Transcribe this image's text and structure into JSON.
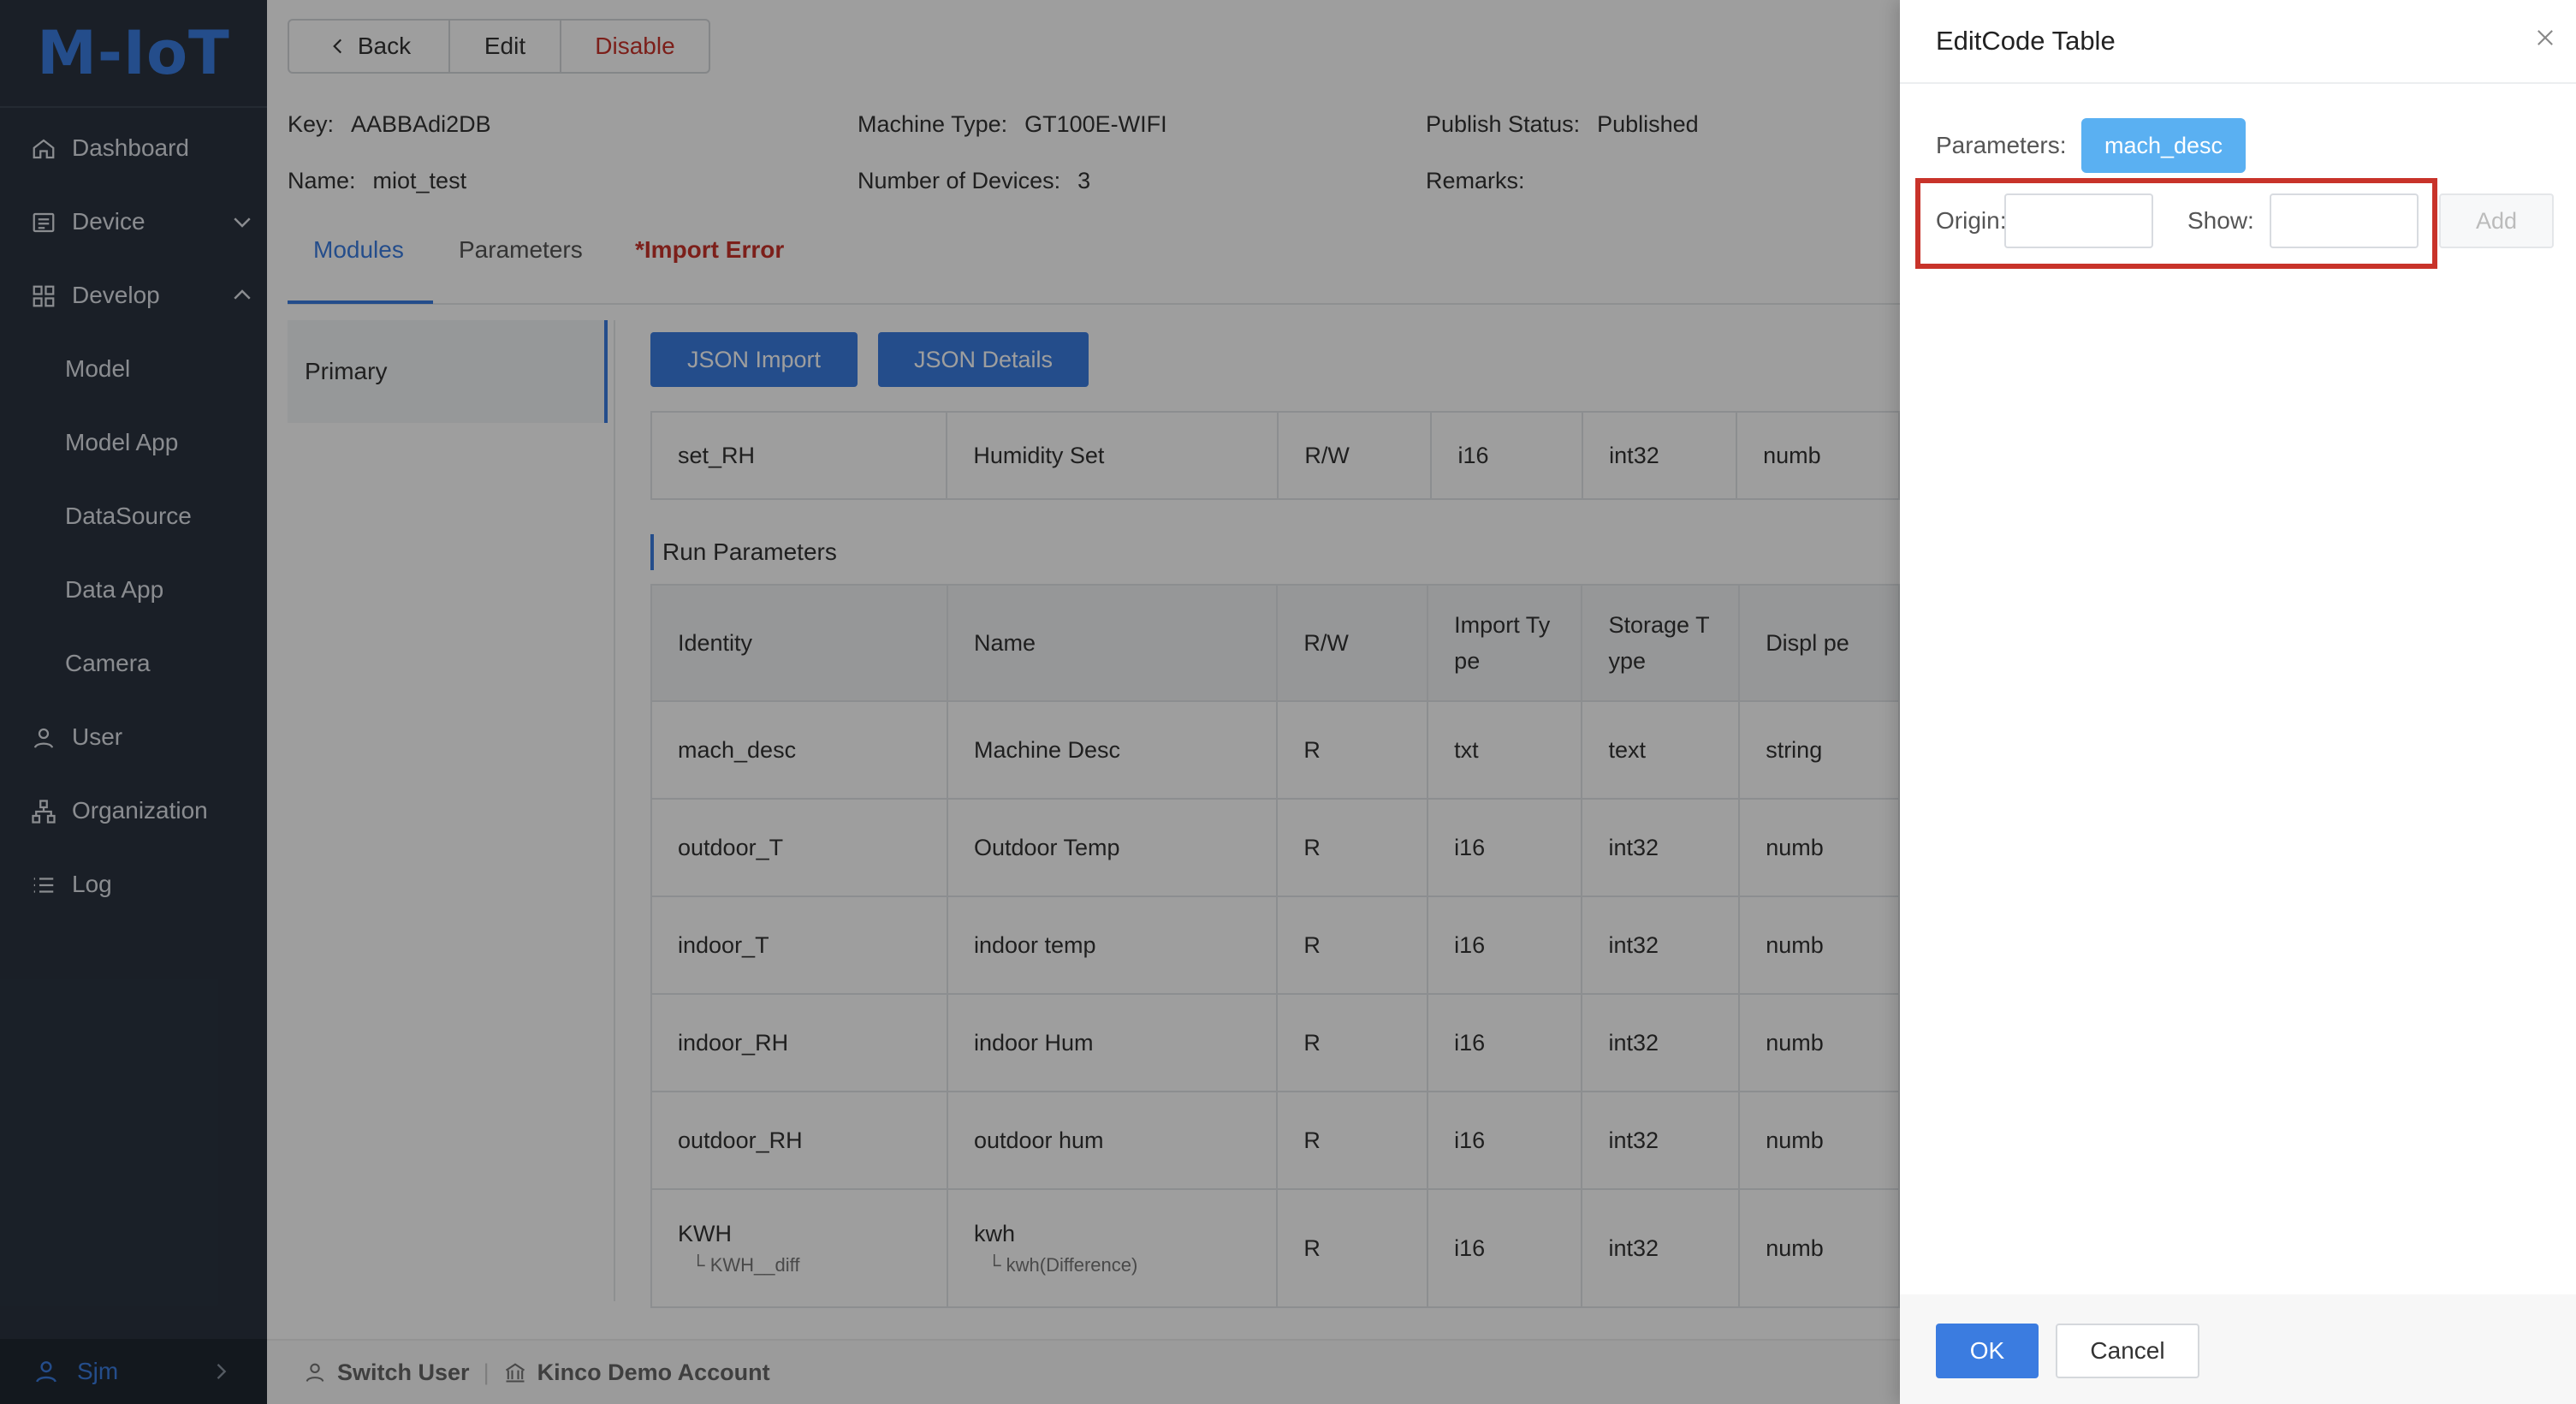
{
  "app": {
    "logo": "M-IoT"
  },
  "sidebar": {
    "items": [
      {
        "label": "Dashboard",
        "icon": "home-icon"
      },
      {
        "label": "Device",
        "icon": "device-icon",
        "expand": "collapsed"
      },
      {
        "label": "Develop",
        "icon": "grid-icon",
        "expand": "expanded"
      },
      {
        "label": "Model",
        "sub": true
      },
      {
        "label": "Model App",
        "sub": true
      },
      {
        "label": "DataSource",
        "sub": true
      },
      {
        "label": "Data App",
        "sub": true
      },
      {
        "label": "Camera",
        "sub": true
      },
      {
        "label": "User",
        "icon": "user-icon"
      },
      {
        "label": "Organization",
        "icon": "org-icon"
      },
      {
        "label": "Log",
        "icon": "list-icon"
      }
    ],
    "current_user": "Sjm"
  },
  "toolbar": {
    "back_label": "Back",
    "edit_label": "Edit",
    "disable_label": "Disable"
  },
  "info": {
    "key_label": "Key:",
    "key_value": "AABBAdi2DB",
    "name_label": "Name:",
    "name_value": "miot_test",
    "machine_type_label": "Machine Type:",
    "machine_type_value": "GT100E-WIFI",
    "devices_label": "Number of Devices:",
    "devices_value": "3",
    "publish_label": "Publish Status:",
    "publish_value": "Published",
    "remarks_label": "Remarks:",
    "remarks_value": ""
  },
  "tabs": [
    {
      "label": "Modules",
      "active": true
    },
    {
      "label": "Parameters",
      "active": false
    },
    {
      "label": "*Import Error",
      "active": false
    }
  ],
  "modules": {
    "primary_label": "Primary"
  },
  "actions": {
    "json_import": "JSON Import",
    "json_details": "JSON Details"
  },
  "set_params_row": {
    "identity": "set_RH",
    "name": "Humidity Set",
    "rw": "R/W",
    "import_type": "i16",
    "storage_type": "int32",
    "display_type": "numb"
  },
  "run_parameters": {
    "title": "Run Parameters",
    "headers": {
      "identity": "Identity",
      "name": "Name",
      "rw": "R/W",
      "import_type": "Import Ty pe",
      "storage_type": "Storage T ype",
      "display_type": "Displ pe"
    },
    "rows": [
      {
        "identity": "mach_desc",
        "name": "Machine Desc",
        "rw": "R",
        "import_type": "txt",
        "storage_type": "text",
        "display_type": "string"
      },
      {
        "identity": "outdoor_T",
        "name": "Outdoor Temp",
        "rw": "R",
        "import_type": "i16",
        "storage_type": "int32",
        "display_type": "numb"
      },
      {
        "identity": "indoor_T",
        "name": "indoor temp",
        "rw": "R",
        "import_type": "i16",
        "storage_type": "int32",
        "display_type": "numb"
      },
      {
        "identity": "indoor_RH",
        "name": "indoor Hum",
        "rw": "R",
        "import_type": "i16",
        "storage_type": "int32",
        "display_type": "numb"
      },
      {
        "identity": "outdoor_RH",
        "name": "outdoor hum",
        "rw": "R",
        "import_type": "i16",
        "storage_type": "int32",
        "display_type": "numb"
      },
      {
        "identity": "KWH",
        "identity_sub": "└ KWH__diff",
        "name": "kwh",
        "name_sub": "└ kwh(Difference)",
        "rw": "R",
        "import_type": "i16",
        "storage_type": "int32",
        "display_type": "numb"
      }
    ]
  },
  "footer": {
    "switch_user": "Switch User",
    "account": "Kinco Demo Account"
  },
  "drawer": {
    "title": "EditCode Table",
    "parameters_label": "Parameters:",
    "parameter_tag": "mach_desc",
    "origin_label": "Origin:",
    "origin_value": "",
    "show_label": "Show:",
    "show_value": "",
    "add_label": "Add",
    "ok_label": "OK",
    "cancel_label": "Cancel"
  },
  "colors": {
    "accent": "#3b7ce0",
    "sidebar": "#2a3340",
    "danger": "#c8332a",
    "tag": "#5ab0f2"
  }
}
